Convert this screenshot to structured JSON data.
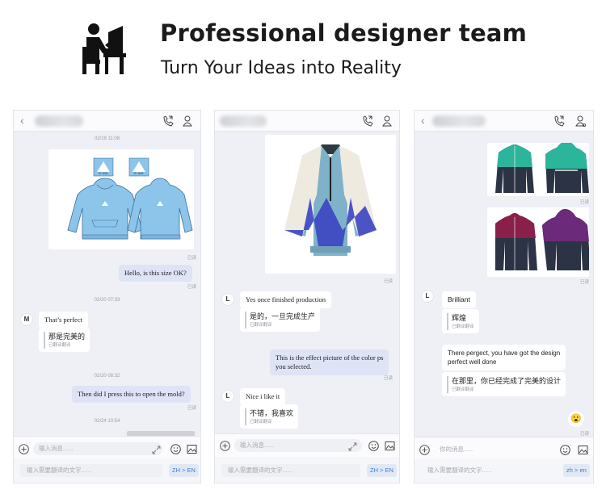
{
  "header": {
    "title": "Professional designer team",
    "subtitle": "Turn Your Ideas into Reality",
    "icon": "designer-at-desk-icon"
  },
  "phones": [
    {
      "timestamps": [
        "02/19 11:08",
        "02/20 07:33",
        "02/20 08:32",
        "02/24 10:54"
      ],
      "read_label": "已读",
      "messages": {
        "out1": "Hello, is this size OK?",
        "in1_en": "That’s perfect",
        "in1_zh": "那是完美的",
        "in1_tr": "已翻译翻译",
        "out2": "Then did I press this to open the mold?"
      },
      "avatar": "M",
      "design_badges": [
        "YK WIN",
        "YK WIN"
      ],
      "input_placeholder": "输入消息......",
      "translate_placeholder": "输入需要翻译的文字......",
      "lang": "ZH > EN"
    },
    {
      "read_label": "已读",
      "messages": {
        "in1_en": "Yes once finished production",
        "in1_zh": "是的，一旦完成生产",
        "in1_tr": "已翻译翻译",
        "out1_l1": "This is the effect picture of the color ps",
        "out1_l2": "you selected.",
        "in2_en": "Nice i like it",
        "in2_zh": "不错，我喜欢",
        "in2_tr": "已翻译翻译"
      },
      "avatar": "L",
      "input_placeholder": "输入消息......",
      "translate_placeholder": "输入需要翻译的文字......",
      "lang": "ZH > EN"
    },
    {
      "read_label": "已读",
      "messages": {
        "in1_en": "Brilliant",
        "in1_zh": "辉煌",
        "in1_tr": "已翻译翻译",
        "in2_l1": "There pergect, you have got the design",
        "in2_l2": "perfect well done",
        "in2_zh": "在那里，你已经完成了完美的设计",
        "in2_tr": "已翻译翻译",
        "emoji": "😮"
      },
      "avatar": "L",
      "input_placeholder": "你的消息......",
      "translate_placeholder": "输入需要翻译的文字......",
      "lang": "zh > en"
    }
  ],
  "colors": {
    "chat_bg": "#eef0f6",
    "outgoing_bubble": "#dfe3f6",
    "incoming_bubble": "#ffffff",
    "hoodie_blue": "#8cc4ea",
    "jacket_teal": "#2bb59b",
    "jacket_purple": "#6b2a7a",
    "jacket_navy": "#2b3345"
  }
}
